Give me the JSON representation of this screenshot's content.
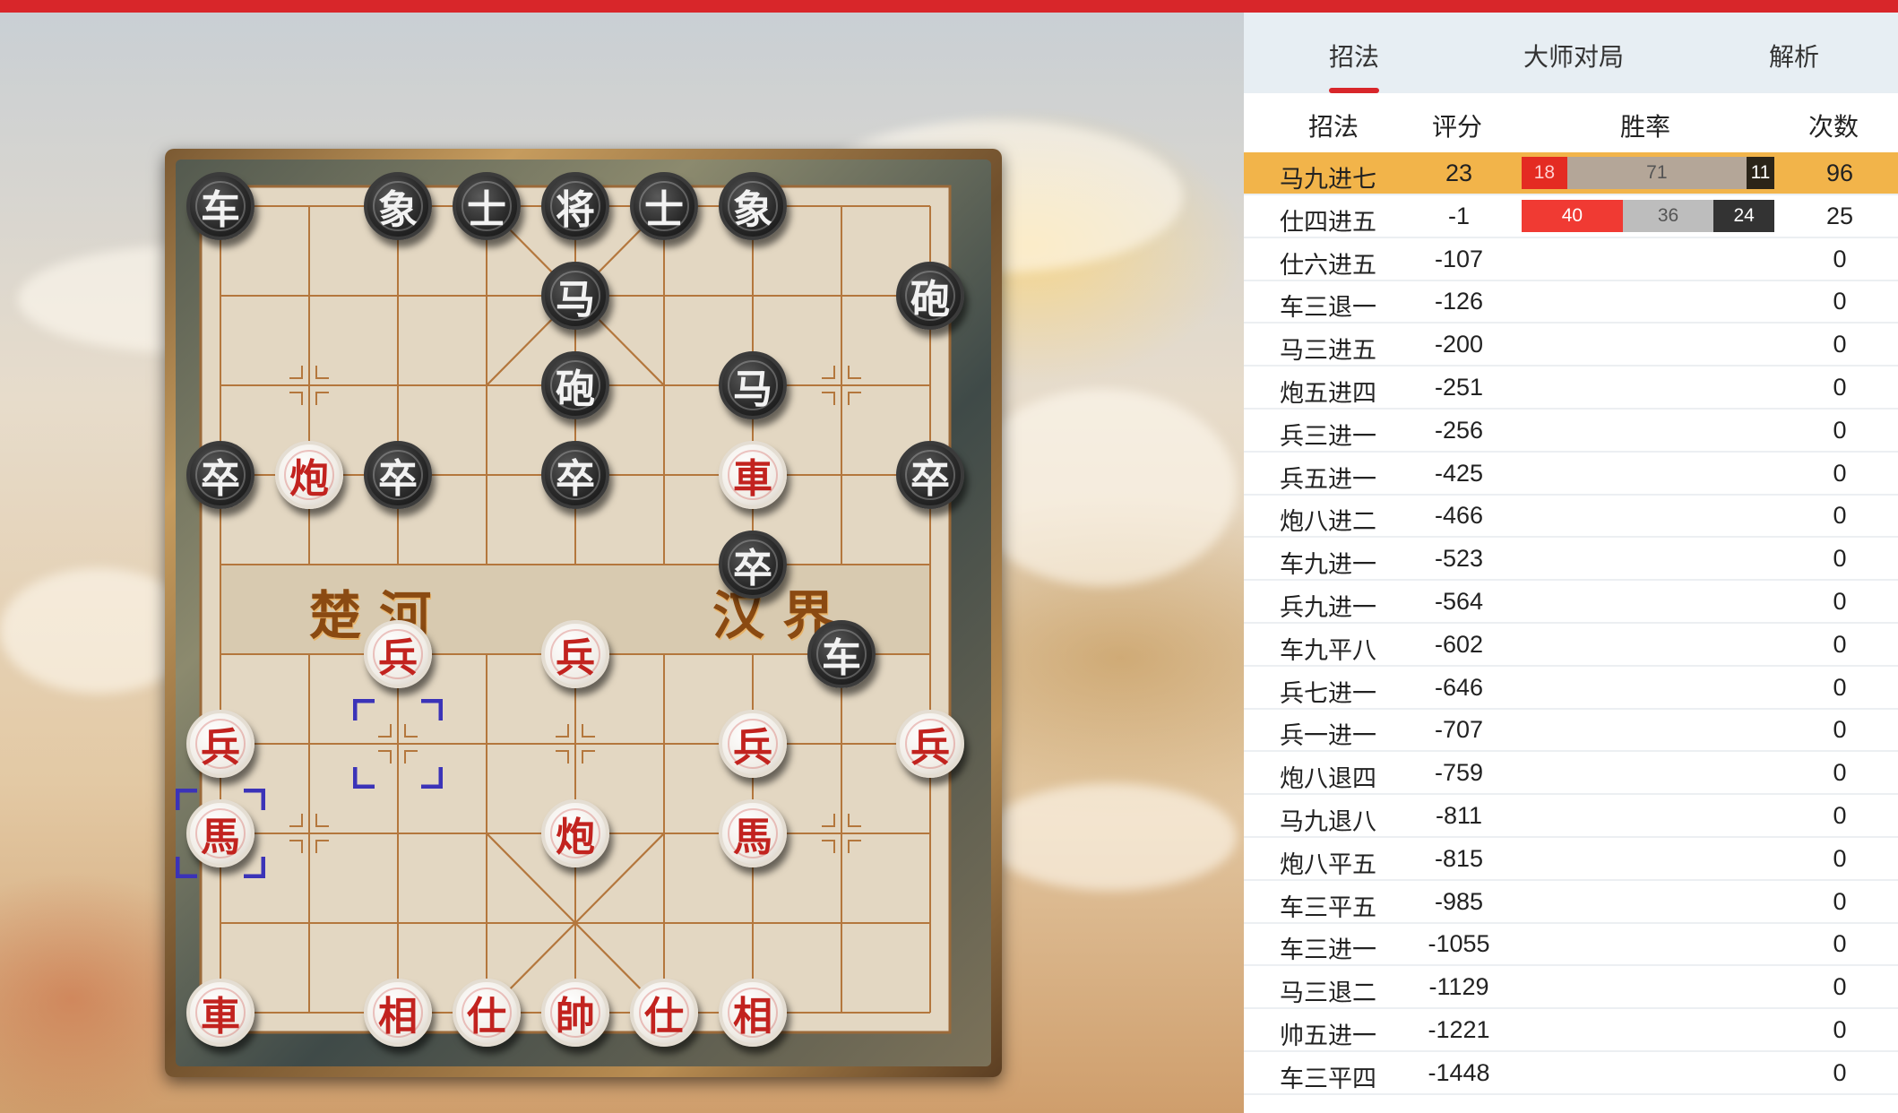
{
  "board": {
    "river_left": "楚 河",
    "river_right": "汉 界",
    "pieces": [
      {
        "label": "车",
        "side": "black",
        "col": 0,
        "row": 0
      },
      {
        "label": "象",
        "side": "black",
        "col": 2,
        "row": 0
      },
      {
        "label": "士",
        "side": "black",
        "col": 3,
        "row": 0
      },
      {
        "label": "将",
        "side": "black",
        "col": 4,
        "row": 0
      },
      {
        "label": "士",
        "side": "black",
        "col": 5,
        "row": 0
      },
      {
        "label": "象",
        "side": "black",
        "col": 6,
        "row": 0
      },
      {
        "label": "马",
        "side": "black",
        "col": 4,
        "row": 1
      },
      {
        "label": "砲",
        "side": "black",
        "col": 8,
        "row": 1
      },
      {
        "label": "砲",
        "side": "black",
        "col": 4,
        "row": 2
      },
      {
        "label": "马",
        "side": "black",
        "col": 6,
        "row": 2
      },
      {
        "label": "卒",
        "side": "black",
        "col": 0,
        "row": 3
      },
      {
        "label": "卒",
        "side": "black",
        "col": 2,
        "row": 3
      },
      {
        "label": "卒",
        "side": "black",
        "col": 4,
        "row": 3
      },
      {
        "label": "卒",
        "side": "black",
        "col": 8,
        "row": 3
      },
      {
        "label": "卒",
        "side": "black",
        "col": 6,
        "row": 4
      },
      {
        "label": "车",
        "side": "black",
        "col": 7,
        "row": 5
      },
      {
        "label": "炮",
        "side": "red",
        "col": 1,
        "row": 3
      },
      {
        "label": "車",
        "side": "red",
        "col": 6,
        "row": 3
      },
      {
        "label": "兵",
        "side": "red",
        "col": 2,
        "row": 5
      },
      {
        "label": "兵",
        "side": "red",
        "col": 4,
        "row": 5
      },
      {
        "label": "兵",
        "side": "red",
        "col": 0,
        "row": 6
      },
      {
        "label": "兵",
        "side": "red",
        "col": 6,
        "row": 6
      },
      {
        "label": "兵",
        "side": "red",
        "col": 8,
        "row": 6
      },
      {
        "label": "馬",
        "side": "red",
        "col": 0,
        "row": 7
      },
      {
        "label": "炮",
        "side": "red",
        "col": 4,
        "row": 7
      },
      {
        "label": "馬",
        "side": "red",
        "col": 6,
        "row": 7
      },
      {
        "label": "車",
        "side": "red",
        "col": 0,
        "row": 9
      },
      {
        "label": "相",
        "side": "red",
        "col": 2,
        "row": 9
      },
      {
        "label": "仕",
        "side": "red",
        "col": 3,
        "row": 9
      },
      {
        "label": "帥",
        "side": "red",
        "col": 4,
        "row": 9
      },
      {
        "label": "仕",
        "side": "red",
        "col": 5,
        "row": 9
      },
      {
        "label": "相",
        "side": "red",
        "col": 6,
        "row": 9
      }
    ],
    "last_move": [
      {
        "col": 2,
        "row": 6
      },
      {
        "col": 0,
        "row": 7
      }
    ],
    "marker_color": "#3b33b8"
  },
  "tabs": [
    {
      "label": "招法",
      "active": true
    },
    {
      "label": "大师对局",
      "active": false
    },
    {
      "label": "解析",
      "active": false
    }
  ],
  "table": {
    "headers": {
      "move": "招法",
      "score": "评分",
      "winrate": "胜率",
      "count": "次数"
    },
    "rows": [
      {
        "move": "马九进七",
        "score": "23",
        "count": "96",
        "selected": true,
        "win": [
          18,
          71,
          11
        ]
      },
      {
        "move": "仕四进五",
        "score": "-1",
        "count": "25",
        "selected": false,
        "win": [
          40,
          36,
          24
        ]
      },
      {
        "move": "仕六进五",
        "score": "-107",
        "count": "0"
      },
      {
        "move": "车三退一",
        "score": "-126",
        "count": "0"
      },
      {
        "move": "马三进五",
        "score": "-200",
        "count": "0"
      },
      {
        "move": "炮五进四",
        "score": "-251",
        "count": "0"
      },
      {
        "move": "兵三进一",
        "score": "-256",
        "count": "0"
      },
      {
        "move": "兵五进一",
        "score": "-425",
        "count": "0"
      },
      {
        "move": "炮八进二",
        "score": "-466",
        "count": "0"
      },
      {
        "move": "车九进一",
        "score": "-523",
        "count": "0"
      },
      {
        "move": "兵九进一",
        "score": "-564",
        "count": "0"
      },
      {
        "move": "车九平八",
        "score": "-602",
        "count": "0"
      },
      {
        "move": "兵七进一",
        "score": "-646",
        "count": "0"
      },
      {
        "move": "兵一进一",
        "score": "-707",
        "count": "0"
      },
      {
        "move": "炮八退四",
        "score": "-759",
        "count": "0"
      },
      {
        "move": "马九退八",
        "score": "-811",
        "count": "0"
      },
      {
        "move": "炮八平五",
        "score": "-815",
        "count": "0"
      },
      {
        "move": "车三平五",
        "score": "-985",
        "count": "0"
      },
      {
        "move": "车三进一",
        "score": "-1055",
        "count": "0"
      },
      {
        "move": "马三退二",
        "score": "-1129",
        "count": "0"
      },
      {
        "move": "帅五进一",
        "score": "-1221",
        "count": "0"
      },
      {
        "move": "车三平四",
        "score": "-1448",
        "count": "0"
      }
    ],
    "win_colors": {
      "selected": [
        "#e42b22",
        "#b4a698",
        "#2b2418"
      ],
      "normal": [
        "#f03a33",
        "#bdbdbd",
        "#333333"
      ]
    }
  },
  "colors": {
    "accent": "#d8262a",
    "selected_row": "#f2b44a"
  }
}
